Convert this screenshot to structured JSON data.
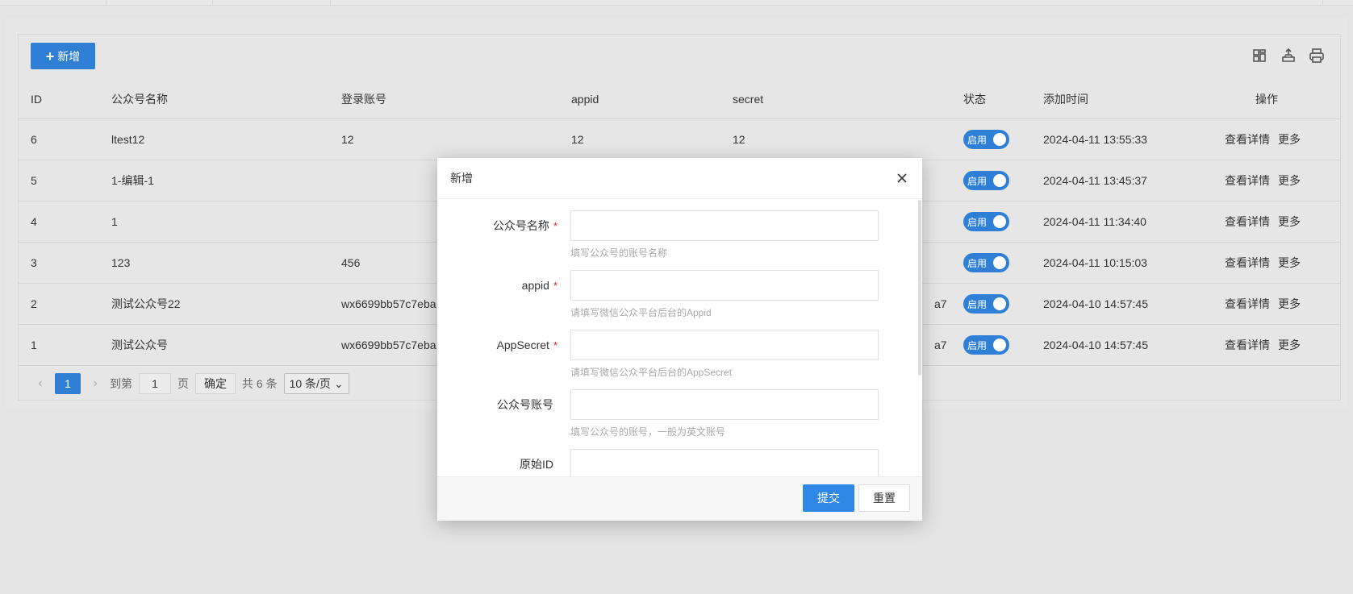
{
  "toolbar": {
    "add_label": "新增",
    "icons": [
      "columns-icon",
      "export-icon",
      "print-icon"
    ]
  },
  "table": {
    "headers": [
      "ID",
      "公众号名称",
      "登录账号",
      "appid",
      "secret",
      "状态",
      "添加时间",
      "操作"
    ],
    "rows": [
      {
        "id": "6",
        "name": "ltest12",
        "login": "12",
        "appid": "12",
        "secret": "12",
        "clip": "",
        "status": "启用",
        "time": "2024-04-11 13:55:33",
        "op_detail": "查看详情",
        "op_more": "更多"
      },
      {
        "id": "5",
        "name": "1-编辑-1",
        "login": "",
        "appid": "",
        "secret": "",
        "clip": "",
        "status": "启用",
        "time": "2024-04-11 13:45:37",
        "op_detail": "查看详情",
        "op_more": "更多"
      },
      {
        "id": "4",
        "name": "1",
        "login": "",
        "appid": "",
        "secret": "",
        "clip": "",
        "status": "启用",
        "time": "2024-04-11 11:34:40",
        "op_detail": "查看详情",
        "op_more": "更多"
      },
      {
        "id": "3",
        "name": "123",
        "login": "456",
        "appid": "",
        "secret": "",
        "clip": "",
        "status": "启用",
        "time": "2024-04-11 10:15:03",
        "op_detail": "查看详情",
        "op_more": "更多"
      },
      {
        "id": "2",
        "name": "测试公众号22",
        "login": "wx6699bb57c7eba",
        "appid": "",
        "secret": "",
        "clip": "a7",
        "status": "启用",
        "time": "2024-04-10 14:57:45",
        "op_detail": "查看详情",
        "op_more": "更多"
      },
      {
        "id": "1",
        "name": "测试公众号",
        "login": "wx6699bb57c7eba",
        "appid": "",
        "secret": "",
        "clip": "a7",
        "status": "启用",
        "time": "2024-04-10 14:57:45",
        "op_detail": "查看详情",
        "op_more": "更多"
      }
    ]
  },
  "pager": {
    "current": "1",
    "goto_label": "到第",
    "page_value": "1",
    "page_unit": "页",
    "confirm": "确定",
    "total": "共 6 条",
    "size": "10 条/页"
  },
  "modal": {
    "title": "新增",
    "fields": [
      {
        "label": "公众号名称",
        "required": "*",
        "hint": "填写公众号的账号名称"
      },
      {
        "label": "appid",
        "required": "*",
        "hint": "请填写微信公众平台后台的Appid"
      },
      {
        "label": "AppSecret",
        "required": "*",
        "hint": "请填写微信公众平台后台的AppSecret"
      },
      {
        "label": "公众号账号",
        "required": "",
        "hint": "填写公众号的账号，一般为英文账号"
      },
      {
        "label": "原始ID",
        "required": "",
        "hint": ""
      }
    ],
    "submit": "提交",
    "reset": "重置"
  },
  "colors": {
    "primary": "#2f7fd6",
    "overlay_bg": "#e4e4e4",
    "required": "#e02020"
  }
}
